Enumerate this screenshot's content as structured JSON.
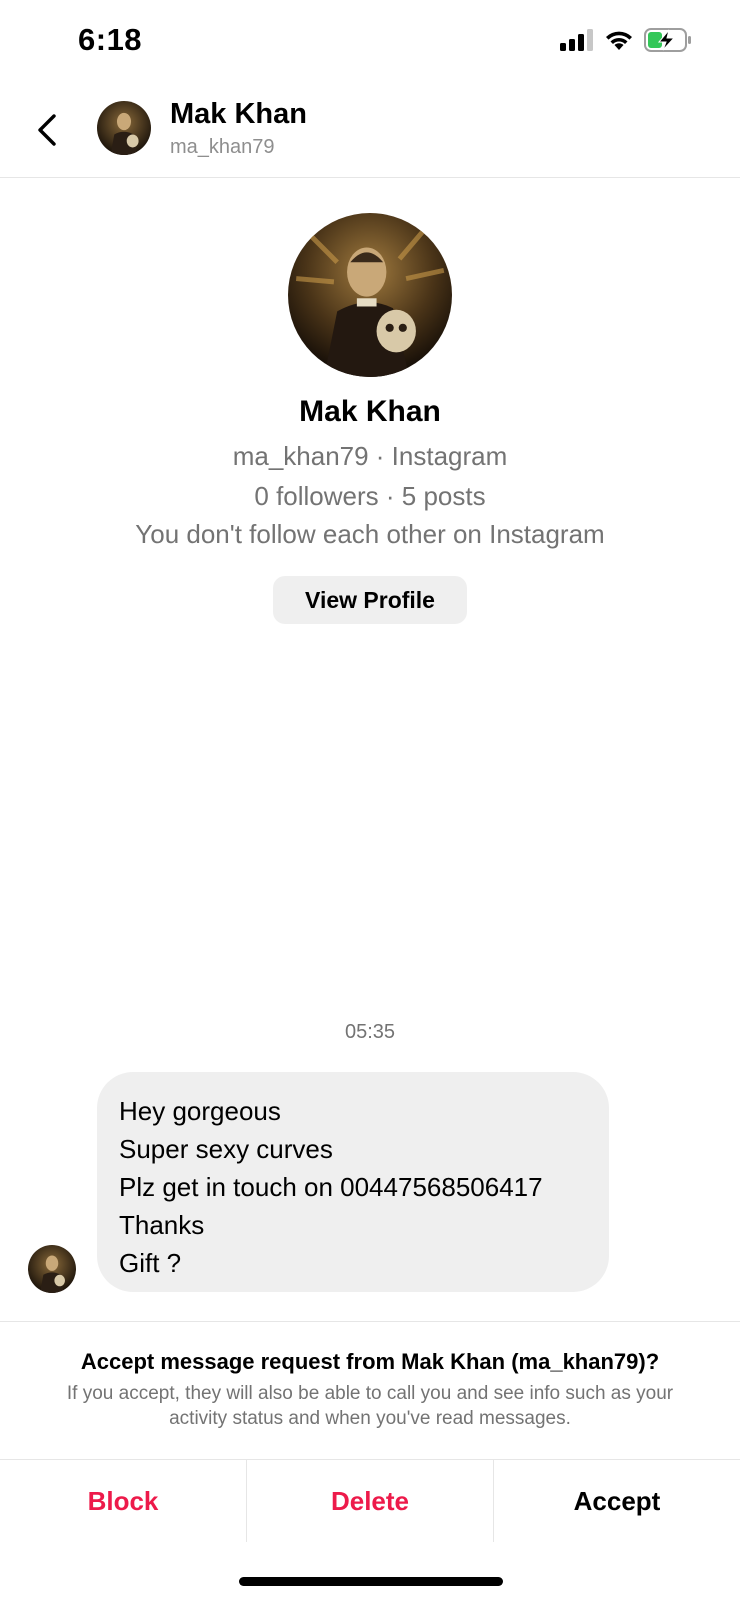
{
  "status_bar": {
    "time": "6:18",
    "icons": [
      "signal-icon",
      "wifi-icon",
      "battery-charging-icon"
    ],
    "battery_color": "#34c759"
  },
  "header": {
    "name": "Mak Khan",
    "username": "ma_khan79",
    "icons": [
      "back-chevron-icon",
      "avatar"
    ]
  },
  "profile": {
    "name": "Mak Khan",
    "subtitle": "ma_khan79 · Instagram",
    "stats": "0 followers · 5 posts",
    "relationship": "You don't follow each other on Instagram",
    "view_profile_label": "View Profile"
  },
  "conversation": {
    "timestamp": "05:35",
    "message_lines": [
      "Hey gorgeous",
      "Super sexy curves",
      "Plz get in touch on 00447568506417",
      "Thanks",
      "Gift ?"
    ]
  },
  "request": {
    "title": "Accept message request from Mak Khan (ma_khan79)?",
    "description": "If you accept, they will also be able to call you and see info such as your activity status and when you've read messages.",
    "actions": {
      "block": "Block",
      "delete": "Delete",
      "accept": "Accept"
    },
    "danger_color": "#ed1a4a"
  }
}
